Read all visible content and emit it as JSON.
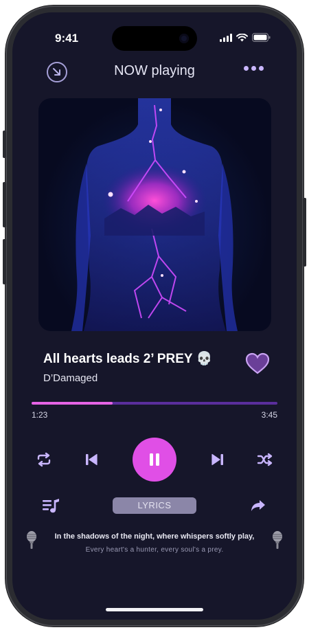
{
  "status_bar": {
    "time": "9:41"
  },
  "header": {
    "title": "NOW playing"
  },
  "track": {
    "title": "All hearts leads 2’ PREY 💀",
    "artist": "D’Damaged"
  },
  "playback": {
    "elapsed": "1:23",
    "total": "3:45",
    "progress": 0.33
  },
  "controls": {
    "icons": [
      "repeat-icon",
      "previous-icon",
      "pause-icon",
      "next-icon",
      "shuffle-icon"
    ]
  },
  "bottom": {
    "lyrics_label": "LYRICS",
    "lyric_line_1": "In the shadows of the night, where whispers softly play,",
    "lyric_line_2": "Every heart's a hunter, every soul's a prey."
  },
  "colors": {
    "background": "#16162a",
    "accent": "#e04fe6",
    "progress_fill": "#e563e4",
    "progress_track": "#5a2e9c",
    "icon": "#c9b6ff"
  }
}
